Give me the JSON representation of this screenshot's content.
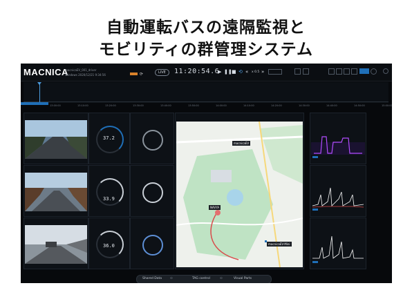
{
  "headline": {
    "line1": "自動運転バスの遠隔監視と",
    "line2": "モビリティの群管理システム"
  },
  "app": {
    "logo": "MACNICA",
    "header_sub1": "macnicaEV_001_driver",
    "header_sub2": "Windows 2020/12/21 9:34:56",
    "live_label": "LIVE",
    "clock": "11:20:54.6",
    "speed": "x 0.5",
    "map_labels": {
      "car1": "macnicaEV",
      "car2": "NAVYA",
      "car3": "macnicaEV-Mini"
    },
    "gauge_values": [
      "37.2",
      "33.9",
      "36.0"
    ],
    "bottom": {
      "shared_data": "Shared Data",
      "tag_control": "TAG control",
      "visual_parts": "Visual Parts"
    },
    "timeline_ticks": [
      "13:00:00",
      "13:10:00",
      "13:20:00",
      "13:30:00",
      "13:40:00",
      "13:50:00",
      "14:00:00",
      "14:10:00",
      "14:20:00",
      "14:30:00",
      "14:40:00",
      "14:50:00",
      "15:00:00"
    ],
    "colors": {
      "accent": "#1f6fb8",
      "chart_purple": "#b24cff",
      "chart_blue": "#4d9de0",
      "badge": "#d9822b"
    }
  }
}
